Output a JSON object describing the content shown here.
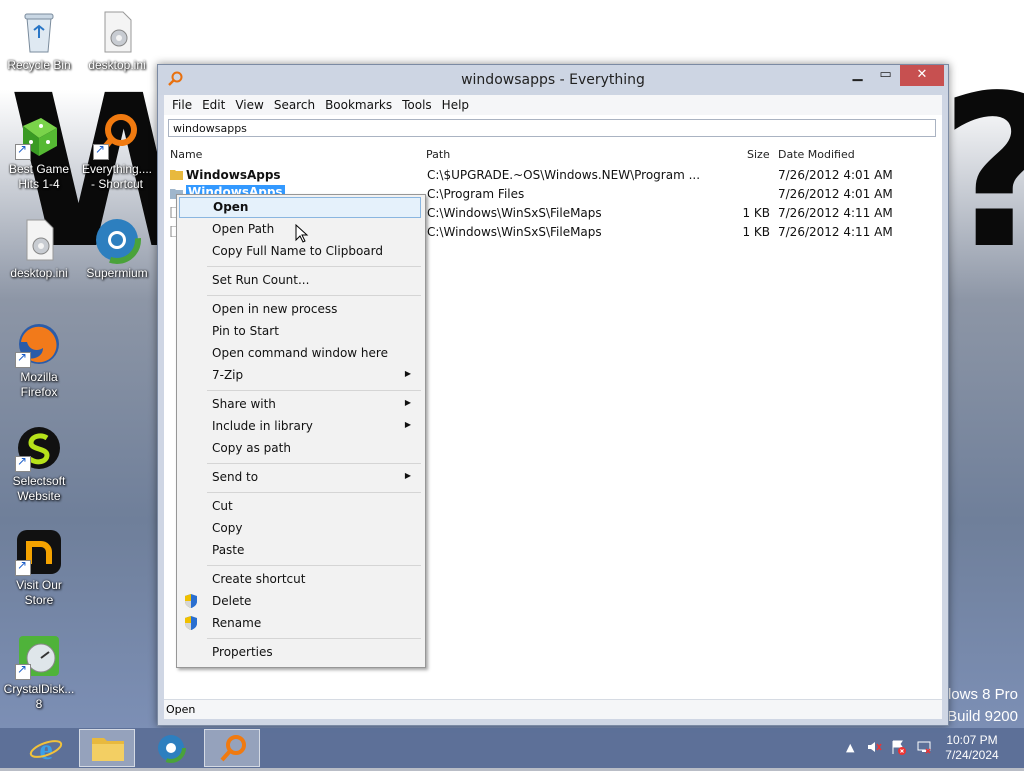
{
  "desktop": {
    "wallpaper_text": "Wh",
    "wallpaper_text_right": "?",
    "os_watermark": [
      "dows 8 Pro",
      "Build 9200"
    ],
    "icons": [
      {
        "label": "Recycle Bin"
      },
      {
        "label": "desktop.ini"
      },
      {
        "label": "Best Game Hits 1-4"
      },
      {
        "label": "Everything.... - Shortcut"
      },
      {
        "label": "desktop.ini"
      },
      {
        "label": "Supermium"
      },
      {
        "label": "Mozilla Firefox"
      },
      {
        "label": "Selectsoft Website"
      },
      {
        "label": "Visit Our Store"
      },
      {
        "label": "CrystalDisk... 8"
      }
    ]
  },
  "window": {
    "title": "windowsapps - Everything",
    "menu": [
      "File",
      "Edit",
      "View",
      "Search",
      "Bookmarks",
      "Tools",
      "Help"
    ],
    "search_value": "windowsapps",
    "columns": {
      "name": "Name",
      "path": "Path",
      "size": "Size",
      "date": "Date Modified"
    },
    "rows": [
      {
        "name": "WindowsApps",
        "path": "C:\\$UPGRADE.~OS\\Windows.NEW\\Program ...",
        "size": "",
        "date": "7/26/2012 4:01 AM"
      },
      {
        "name": "WindowsApps",
        "path": "C:\\Program Files",
        "size": "",
        "date": "7/26/2012 4:01 AM"
      },
      {
        "name": "",
        "path": "C:\\Windows\\WinSxS\\FileMaps",
        "size": "1 KB",
        "date": "7/26/2012 4:11 AM"
      },
      {
        "name": "",
        "path": "C:\\Windows\\WinSxS\\FileMaps",
        "size": "1 KB",
        "date": "7/26/2012 4:11 AM"
      }
    ],
    "status": "Open"
  },
  "context_menu": {
    "items": [
      {
        "label": "Open"
      },
      {
        "label": "Open Path"
      },
      {
        "label": "Copy Full Name to Clipboard"
      },
      {
        "label": "Set Run Count..."
      },
      {
        "label": "Open in new process"
      },
      {
        "label": "Pin to Start"
      },
      {
        "label": "Open command window here"
      },
      {
        "label": "7-Zip"
      },
      {
        "label": "Share with"
      },
      {
        "label": "Include in library"
      },
      {
        "label": "Copy as path"
      },
      {
        "label": "Send to"
      },
      {
        "label": "Cut"
      },
      {
        "label": "Copy"
      },
      {
        "label": "Paste"
      },
      {
        "label": "Create shortcut"
      },
      {
        "label": "Delete"
      },
      {
        "label": "Rename"
      },
      {
        "label": "Properties"
      }
    ]
  },
  "taskbar": {
    "time": "10:07 PM",
    "date": "7/24/2024",
    "tray_arrow": "▲"
  }
}
